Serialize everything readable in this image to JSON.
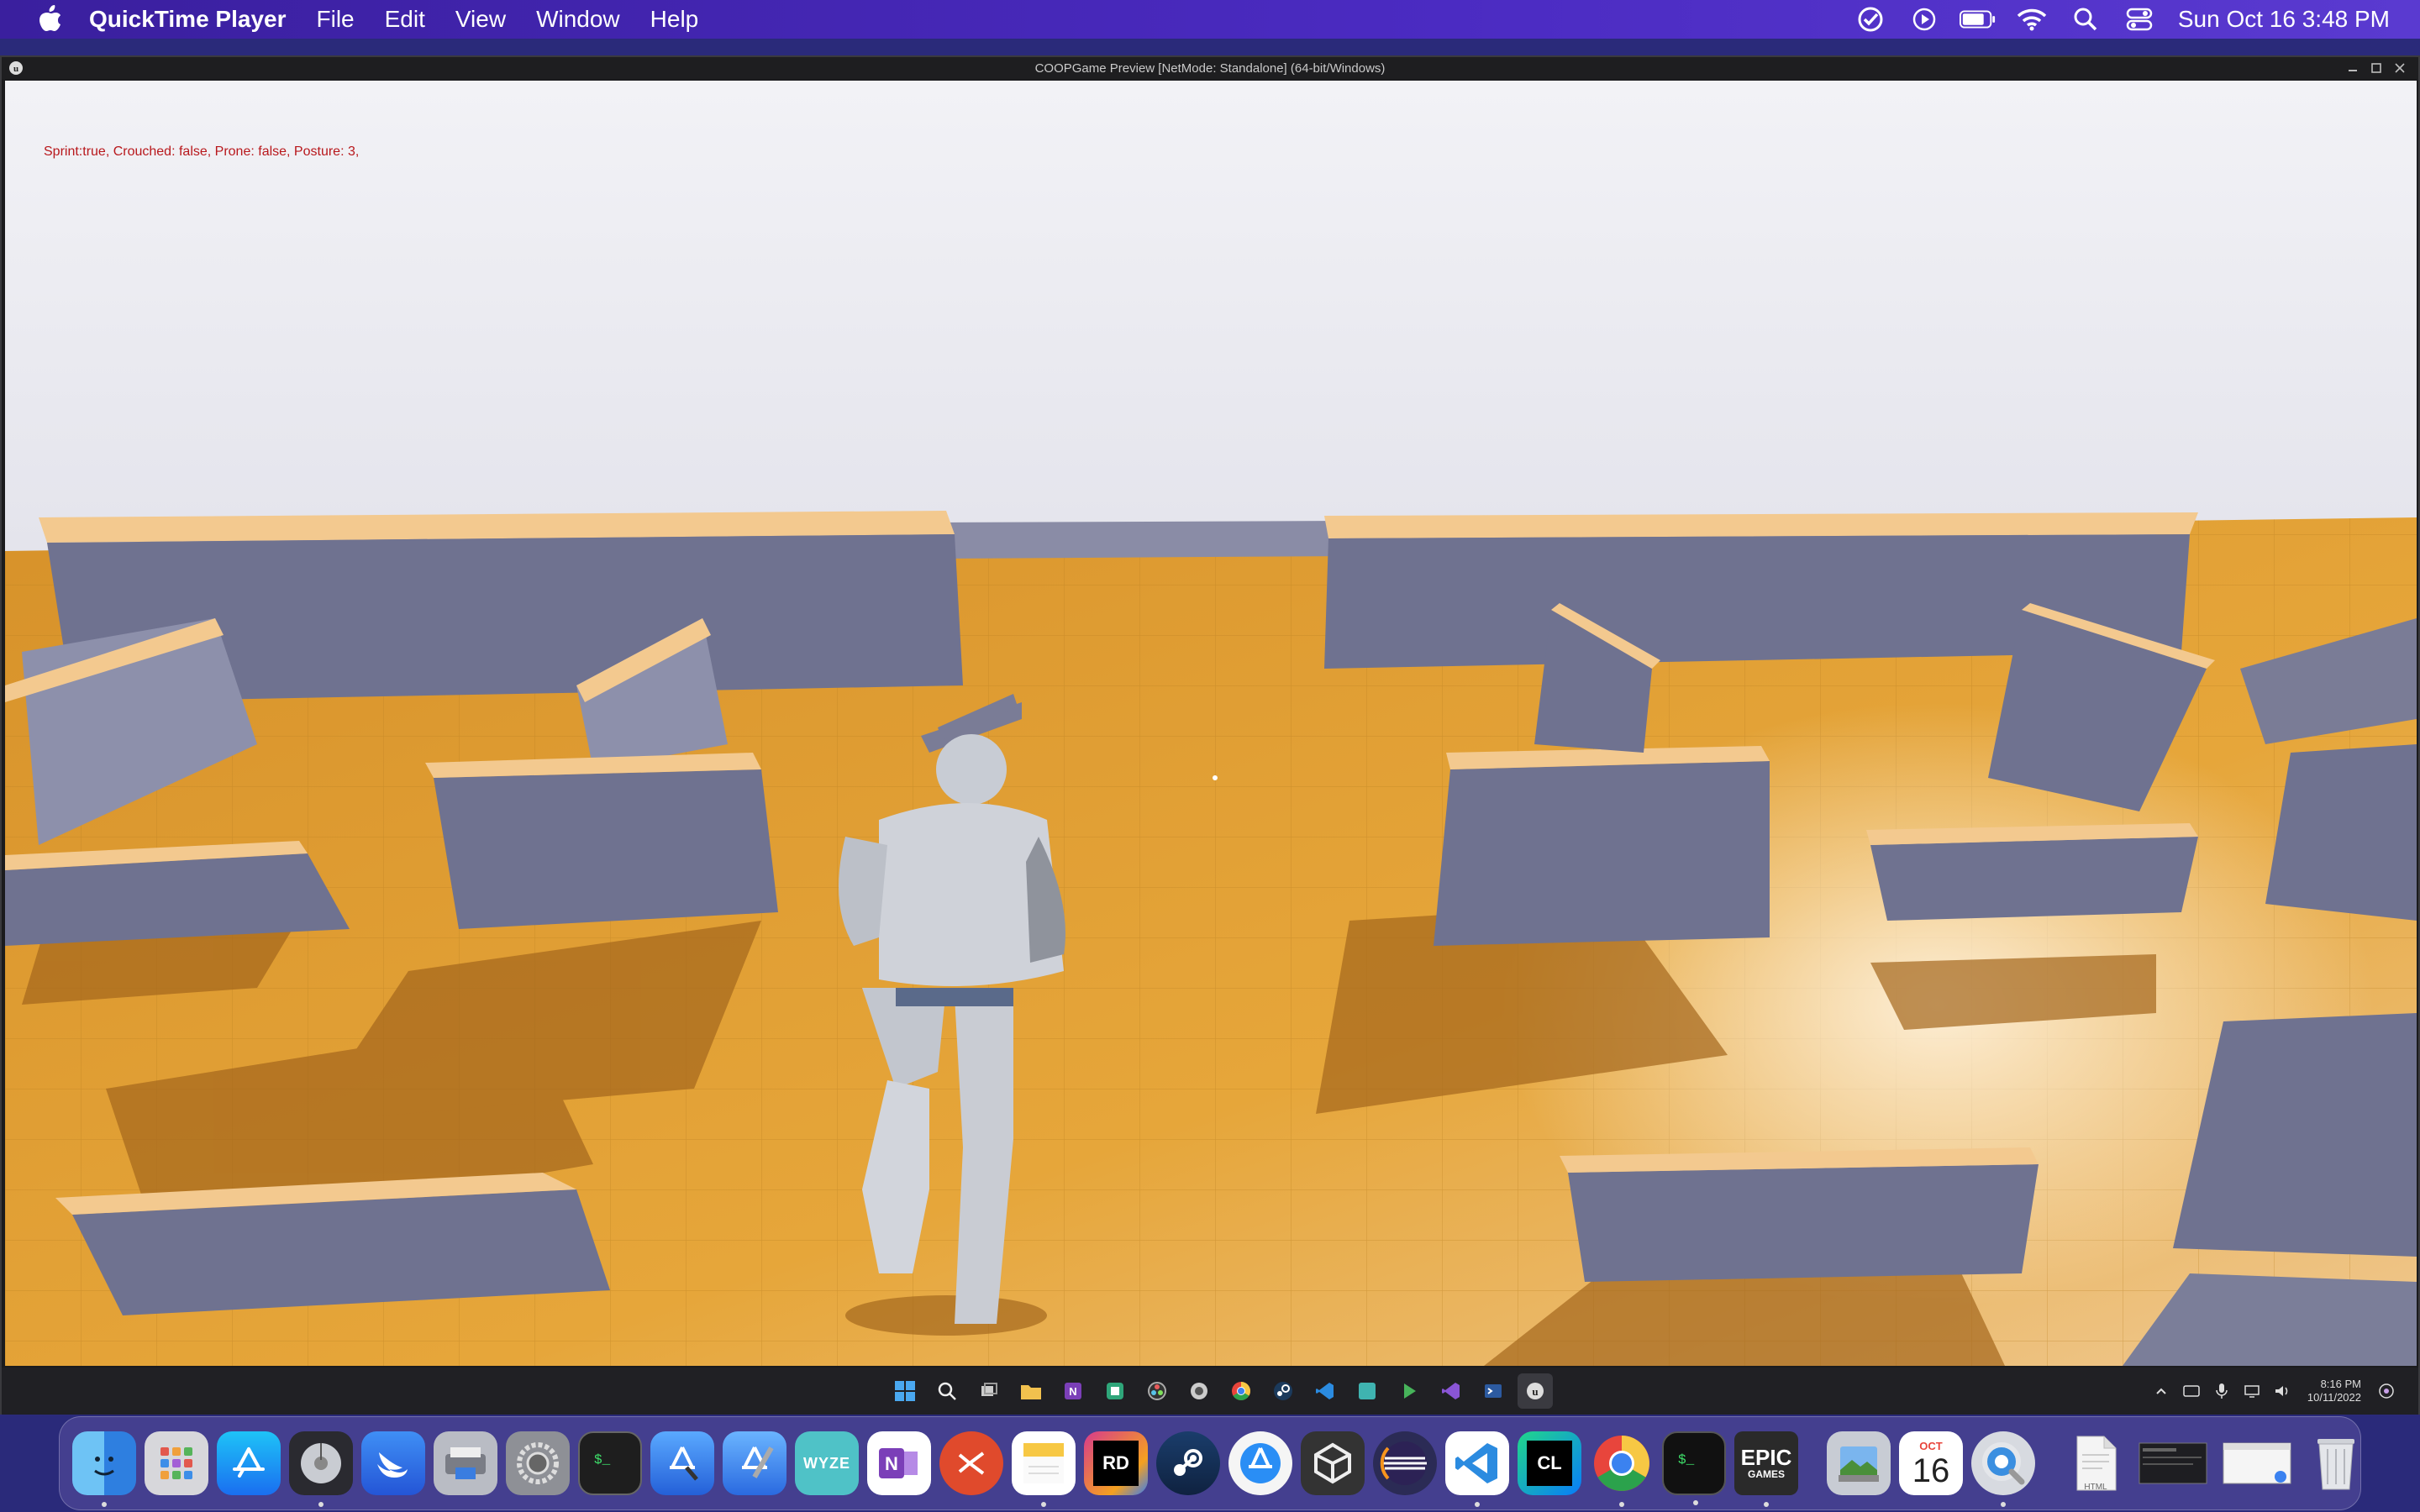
{
  "menubar": {
    "app_name": "QuickTime Player",
    "menus": [
      "File",
      "Edit",
      "View",
      "Window",
      "Help"
    ],
    "clock": "Sun Oct 16  3:48 PM"
  },
  "window": {
    "title": "COOPGame Preview [NetMode: Standalone]  (64-bit/Windows)"
  },
  "game": {
    "debug_text": "Sprint:true, Crouched: false, Prone: false, Posture: 3,"
  },
  "taskbar": {
    "time": "8:16 PM",
    "date": "10/11/2022"
  },
  "dock": {
    "epic_line1": "EPIC",
    "epic_line2": "GAMES",
    "calendar_month": "OCT",
    "calendar_day": "16",
    "cl_label": "CL",
    "rd_label": "RD",
    "wyze_label": "WYZE",
    "html_label": "HTML"
  },
  "colors": {
    "floor": "#e3a12e",
    "wall_top": "#f3c98f",
    "wall_side": "#6f7290",
    "sky": "#ececf1",
    "debug_text": "#b8181c"
  }
}
